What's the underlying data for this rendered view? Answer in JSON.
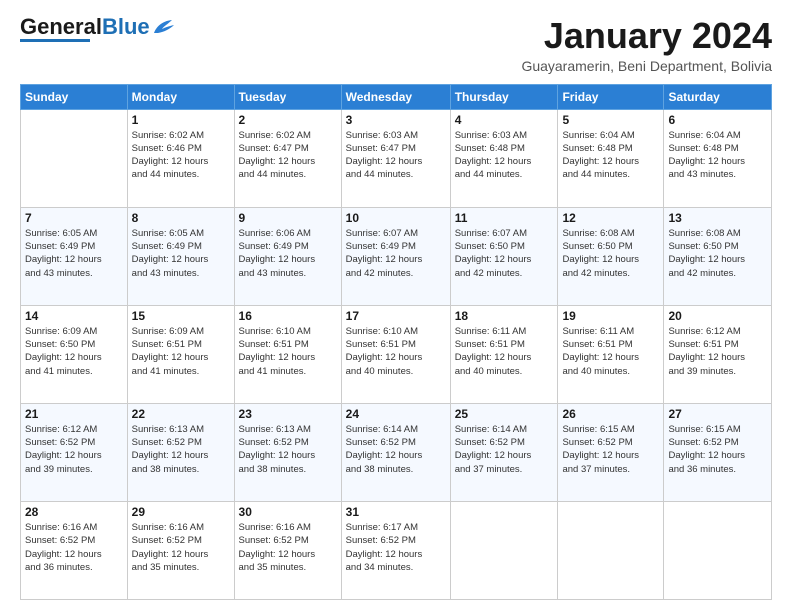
{
  "header": {
    "logo_general": "General",
    "logo_blue": "Blue",
    "month_title": "January 2024",
    "location": "Guayaramerin, Beni Department, Bolivia"
  },
  "calendar": {
    "days_of_week": [
      "Sunday",
      "Monday",
      "Tuesday",
      "Wednesday",
      "Thursday",
      "Friday",
      "Saturday"
    ],
    "weeks": [
      [
        {
          "day": "",
          "info": ""
        },
        {
          "day": "1",
          "info": "Sunrise: 6:02 AM\nSunset: 6:46 PM\nDaylight: 12 hours\nand 44 minutes."
        },
        {
          "day": "2",
          "info": "Sunrise: 6:02 AM\nSunset: 6:47 PM\nDaylight: 12 hours\nand 44 minutes."
        },
        {
          "day": "3",
          "info": "Sunrise: 6:03 AM\nSunset: 6:47 PM\nDaylight: 12 hours\nand 44 minutes."
        },
        {
          "day": "4",
          "info": "Sunrise: 6:03 AM\nSunset: 6:48 PM\nDaylight: 12 hours\nand 44 minutes."
        },
        {
          "day": "5",
          "info": "Sunrise: 6:04 AM\nSunset: 6:48 PM\nDaylight: 12 hours\nand 44 minutes."
        },
        {
          "day": "6",
          "info": "Sunrise: 6:04 AM\nSunset: 6:48 PM\nDaylight: 12 hours\nand 43 minutes."
        }
      ],
      [
        {
          "day": "7",
          "info": "Sunrise: 6:05 AM\nSunset: 6:49 PM\nDaylight: 12 hours\nand 43 minutes."
        },
        {
          "day": "8",
          "info": "Sunrise: 6:05 AM\nSunset: 6:49 PM\nDaylight: 12 hours\nand 43 minutes."
        },
        {
          "day": "9",
          "info": "Sunrise: 6:06 AM\nSunset: 6:49 PM\nDaylight: 12 hours\nand 43 minutes."
        },
        {
          "day": "10",
          "info": "Sunrise: 6:07 AM\nSunset: 6:49 PM\nDaylight: 12 hours\nand 42 minutes."
        },
        {
          "day": "11",
          "info": "Sunrise: 6:07 AM\nSunset: 6:50 PM\nDaylight: 12 hours\nand 42 minutes."
        },
        {
          "day": "12",
          "info": "Sunrise: 6:08 AM\nSunset: 6:50 PM\nDaylight: 12 hours\nand 42 minutes."
        },
        {
          "day": "13",
          "info": "Sunrise: 6:08 AM\nSunset: 6:50 PM\nDaylight: 12 hours\nand 42 minutes."
        }
      ],
      [
        {
          "day": "14",
          "info": "Sunrise: 6:09 AM\nSunset: 6:50 PM\nDaylight: 12 hours\nand 41 minutes."
        },
        {
          "day": "15",
          "info": "Sunrise: 6:09 AM\nSunset: 6:51 PM\nDaylight: 12 hours\nand 41 minutes."
        },
        {
          "day": "16",
          "info": "Sunrise: 6:10 AM\nSunset: 6:51 PM\nDaylight: 12 hours\nand 41 minutes."
        },
        {
          "day": "17",
          "info": "Sunrise: 6:10 AM\nSunset: 6:51 PM\nDaylight: 12 hours\nand 40 minutes."
        },
        {
          "day": "18",
          "info": "Sunrise: 6:11 AM\nSunset: 6:51 PM\nDaylight: 12 hours\nand 40 minutes."
        },
        {
          "day": "19",
          "info": "Sunrise: 6:11 AM\nSunset: 6:51 PM\nDaylight: 12 hours\nand 40 minutes."
        },
        {
          "day": "20",
          "info": "Sunrise: 6:12 AM\nSunset: 6:51 PM\nDaylight: 12 hours\nand 39 minutes."
        }
      ],
      [
        {
          "day": "21",
          "info": "Sunrise: 6:12 AM\nSunset: 6:52 PM\nDaylight: 12 hours\nand 39 minutes."
        },
        {
          "day": "22",
          "info": "Sunrise: 6:13 AM\nSunset: 6:52 PM\nDaylight: 12 hours\nand 38 minutes."
        },
        {
          "day": "23",
          "info": "Sunrise: 6:13 AM\nSunset: 6:52 PM\nDaylight: 12 hours\nand 38 minutes."
        },
        {
          "day": "24",
          "info": "Sunrise: 6:14 AM\nSunset: 6:52 PM\nDaylight: 12 hours\nand 38 minutes."
        },
        {
          "day": "25",
          "info": "Sunrise: 6:14 AM\nSunset: 6:52 PM\nDaylight: 12 hours\nand 37 minutes."
        },
        {
          "day": "26",
          "info": "Sunrise: 6:15 AM\nSunset: 6:52 PM\nDaylight: 12 hours\nand 37 minutes."
        },
        {
          "day": "27",
          "info": "Sunrise: 6:15 AM\nSunset: 6:52 PM\nDaylight: 12 hours\nand 36 minutes."
        }
      ],
      [
        {
          "day": "28",
          "info": "Sunrise: 6:16 AM\nSunset: 6:52 PM\nDaylight: 12 hours\nand 36 minutes."
        },
        {
          "day": "29",
          "info": "Sunrise: 6:16 AM\nSunset: 6:52 PM\nDaylight: 12 hours\nand 35 minutes."
        },
        {
          "day": "30",
          "info": "Sunrise: 6:16 AM\nSunset: 6:52 PM\nDaylight: 12 hours\nand 35 minutes."
        },
        {
          "day": "31",
          "info": "Sunrise: 6:17 AM\nSunset: 6:52 PM\nDaylight: 12 hours\nand 34 minutes."
        },
        {
          "day": "",
          "info": ""
        },
        {
          "day": "",
          "info": ""
        },
        {
          "day": "",
          "info": ""
        }
      ]
    ]
  }
}
